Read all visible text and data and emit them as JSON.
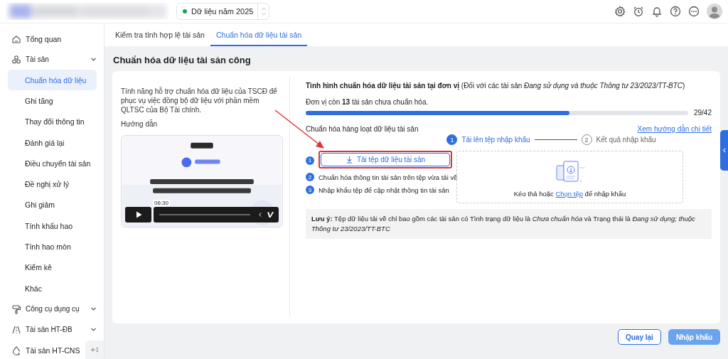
{
  "year_selector": {
    "label": "Dữ liệu năm 2025",
    "active": true
  },
  "sidebar": {
    "items": [
      {
        "label": "Tổng quan",
        "kind": "link",
        "selected": false
      },
      {
        "label": "Tài sản",
        "kind": "group",
        "selected": false,
        "expanded": true,
        "children": [
          {
            "label": "Chuẩn hóa dữ liệu",
            "selected": true
          },
          {
            "label": "Ghi tăng",
            "selected": false
          },
          {
            "label": "Thay đổi thông tin",
            "selected": false
          },
          {
            "label": "Đánh giá lại",
            "selected": false
          },
          {
            "label": "Điều chuyển tài sản",
            "selected": false
          },
          {
            "label": "Đề nghị xử lý",
            "selected": false
          },
          {
            "label": "Ghi giảm",
            "selected": false
          },
          {
            "label": "Tính khấu hao",
            "selected": false
          },
          {
            "label": "Tính hao mòn",
            "selected": false
          },
          {
            "label": "Kiểm kê",
            "selected": false
          },
          {
            "label": "Khác",
            "selected": false
          }
        ]
      },
      {
        "label": "Công cụ dụng cụ",
        "kind": "group",
        "selected": false
      },
      {
        "label": "Tài sản HT-ĐB",
        "kind": "group",
        "selected": false
      },
      {
        "label": "Tài sản HT-CNS",
        "kind": "link",
        "selected": false
      }
    ]
  },
  "tabs": [
    {
      "label": "Kiểm tra tính hợp lệ tài sản",
      "selected": false
    },
    {
      "label": "Chuẩn hóa dữ liệu tài sản",
      "selected": true
    }
  ],
  "page_title": "Chuẩn hóa dữ liệu tài sản công",
  "intro": {
    "description": "Tính năng hỗ trợ chuẩn hóa dữ liệu của TSCĐ để phục vụ việc đồng bộ dữ liệu với phần mềm QLTSC của Bộ Tài chính.",
    "guide_label": "Hướng dẫn",
    "video": {
      "kind": "picture",
      "time": "06:30"
    }
  },
  "status": {
    "heading": "**Tình hình chuẩn hóa dữ liệu tài sản tại đơn vị** (Đối với các tài sản *Đang sử dụng và thuộc Thông tư 23/2023/TT-BTC*)",
    "remaining": "Đơn vị còn **13** tài sản chưa chuẩn hóa.",
    "level": 0.69,
    "reading": "29/42"
  },
  "batch": {
    "title": "Chuẩn hóa hàng loạt dữ liệu tài sản",
    "guide_link": "Xem hướng dẫn chi tiết",
    "steps": [
      {
        "number": "1",
        "label": "Tải lên tệp nhập khẩu",
        "selected": true
      },
      {
        "number": "2",
        "label": "Kết quả nhập khẩu",
        "selected": false
      }
    ],
    "instructions": [
      {
        "number": "1",
        "kind": "button",
        "label": "Tải tệp dữ liệu tài sản",
        "highlighted": true
      },
      {
        "number": "2",
        "kind": "text",
        "label": "Chuẩn hóa thông tin tài sản trên tệp vừa tải về"
      },
      {
        "number": "3",
        "kind": "text",
        "label": "Nhập khẩu tệp để cập nhật thông tin tài sản"
      }
    ],
    "drop_zone": {
      "before": "Kéo thả hoặc ",
      "link": "Chọn tệp",
      "after": " để nhập khẩu"
    },
    "note": "**Lưu ý:** Tệp dữ liệu tải về chỉ bao gồm các tài sản có Tình trạng dữ liệu là *Chưa chuẩn hóa* và Trạng thái là *Đang sử dụng; thuộc Thông tư 23/2023/TT-BTC*"
  },
  "footer_buttons": [
    {
      "label": "Quay lại",
      "kind": "secondary",
      "disabled": false
    },
    {
      "label": "Nhập khẩu",
      "kind": "primary",
      "disabled": true
    }
  ]
}
